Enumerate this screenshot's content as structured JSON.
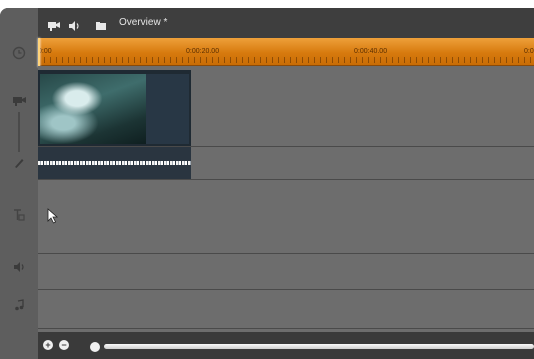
{
  "window": {
    "title": "Overview *"
  },
  "ruler": {
    "ticks": [
      "0:00",
      "0:00:20.00",
      "0:00:40.00",
      "0:0"
    ]
  },
  "toolbar": {
    "icons": [
      "camera-icon",
      "speaker-icon",
      "folder-icon"
    ]
  },
  "sidebar": {
    "icons": [
      "clock-icon",
      "camera-track-icon",
      "pen-icon",
      "title-icon",
      "audio-track-icon",
      "music-note-icon"
    ]
  },
  "bottombar": {
    "zoom_in_label": "+",
    "zoom_out_label": "−"
  },
  "colors": {
    "ruler": "#e08a1e",
    "background": "#6d6d6d",
    "clip": "#1f2a33"
  }
}
